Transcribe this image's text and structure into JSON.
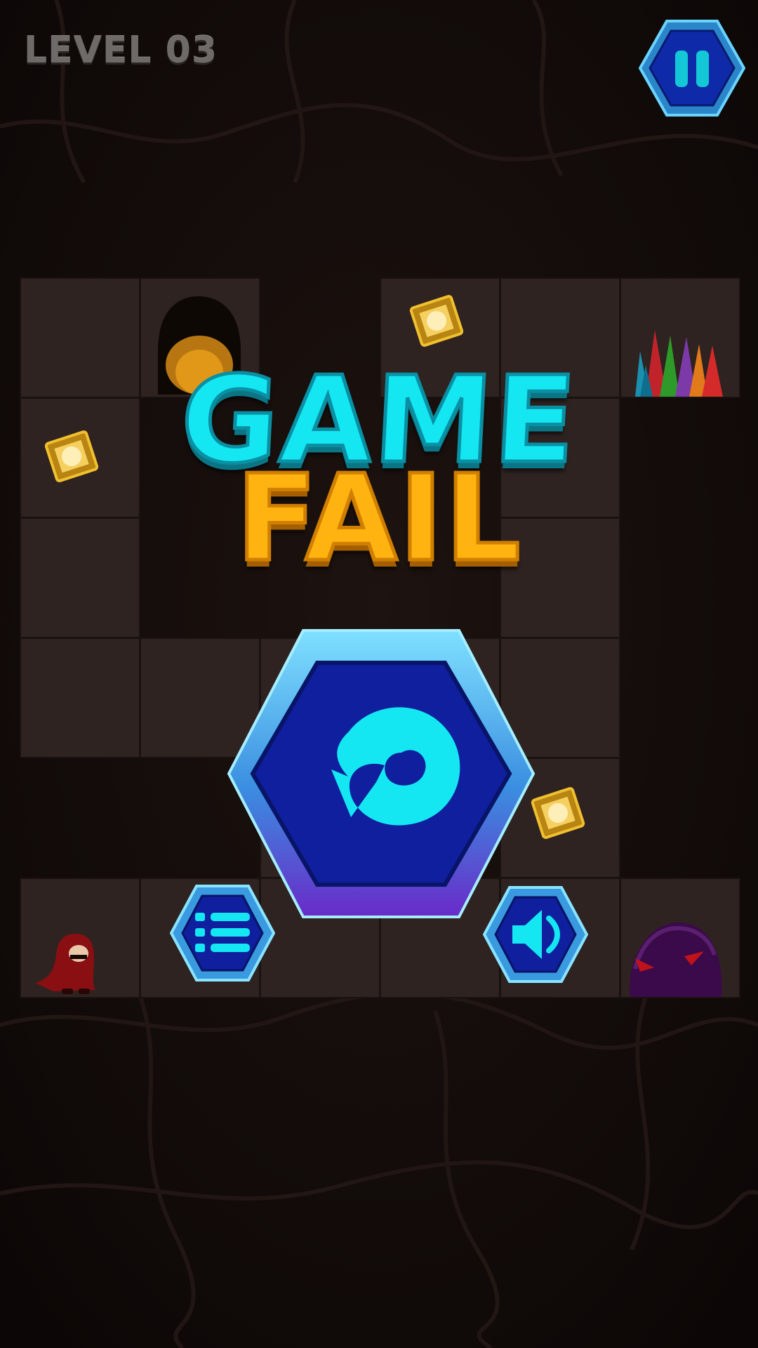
{
  "hud": {
    "level_label": "LEVEL 03",
    "pause_icon": "pause-icon"
  },
  "overlay": {
    "title_line1": "GAME",
    "title_line2": "FAIL"
  },
  "buttons": {
    "retry_icon": "retry-icon",
    "menu_icon": "menu-list-icon",
    "sound_icon": "speaker-icon"
  },
  "board": {
    "columns": 6,
    "rows": 6,
    "floor_tiles": [
      [
        0,
        0
      ],
      [
        1,
        0
      ],
      [
        3,
        0
      ],
      [
        4,
        0
      ],
      [
        5,
        0
      ],
      [
        0,
        1
      ],
      [
        4,
        1
      ],
      [
        0,
        2
      ],
      [
        4,
        2
      ],
      [
        0,
        3
      ],
      [
        1,
        3
      ],
      [
        2,
        3
      ],
      [
        3,
        3
      ],
      [
        4,
        3
      ],
      [
        2,
        4
      ],
      [
        4,
        4
      ],
      [
        0,
        5
      ],
      [
        1,
        5
      ],
      [
        2,
        5
      ],
      [
        3,
        5
      ],
      [
        4,
        5
      ],
      [
        5,
        5
      ]
    ],
    "gems": [
      [
        3,
        0
      ],
      [
        0,
        1
      ],
      [
        4,
        4
      ]
    ],
    "exit_door": [
      1,
      0
    ],
    "crystals": [
      5,
      0
    ],
    "player": [
      0,
      5
    ],
    "enemy": [
      5,
      5
    ]
  },
  "colors": {
    "cyan": "#14e6f2",
    "orange": "#ffb310",
    "button_blue": "#0f2aa8",
    "button_rim": "#5cc8f5"
  }
}
